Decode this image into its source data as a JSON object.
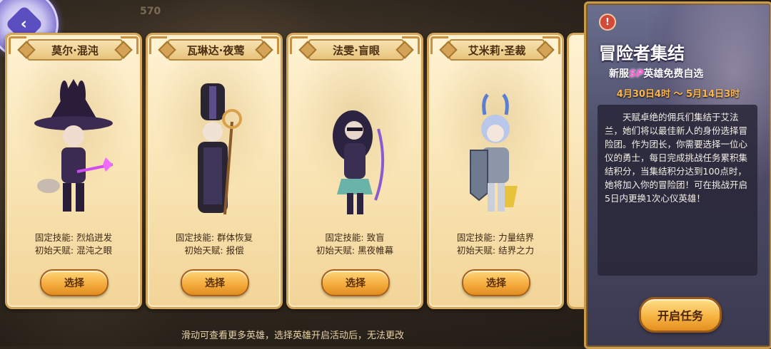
{
  "top": {
    "counter": "570"
  },
  "cards": [
    {
      "name": "莫尔·混沌",
      "fixed_skill": "固定技能: 烈焰迸发",
      "initial_talent": "初始天赋: 混沌之眼",
      "select_label": "选择",
      "hero_color": "#3b2a52",
      "accent_color": "#d04cf0"
    },
    {
      "name": "瓦琳达·夜莺",
      "fixed_skill": "固定技能: 群体恢复",
      "initial_talent": "初始天赋: 报偿",
      "select_label": "选择",
      "hero_color": "#2a2533",
      "accent_color": "#d9a24a"
    },
    {
      "name": "法雯·盲眼",
      "fixed_skill": "固定技能: 致盲",
      "initial_talent": "初始天赋: 黑夜帷幕",
      "select_label": "选择",
      "hero_color": "#2c2340",
      "accent_color": "#8a5ad0"
    },
    {
      "name": "艾米莉·圣裁",
      "fixed_skill": "固定技能: 力量结界",
      "initial_talent": "初始天赋: 结界之力",
      "select_label": "选择",
      "hero_color": "#8c96a8",
      "accent_color": "#e8c23a"
    }
  ],
  "hint": "滑动可查看更多英雄，选择英雄开启活动后，无法更改",
  "panel": {
    "alert": "!",
    "title": "冒险者集结",
    "subtitle_pre": "新服",
    "subtitle_sp": "SP",
    "subtitle_post": "英雄免费自选",
    "date": "4月30日4时 ～ 5月14日3时",
    "description": "天赋卓绝的佣兵们集结于艾法兰，她们将以最佳新人的身份选择冒险团。作为团长，你需要选择一位心仪的勇士，每日完成挑战任务累积集结积分，当集结积分达到100点时，她将加入你的冒险团！可在挑战开启5日内更换1次心仪英雄！",
    "start_label": "开启任务"
  },
  "colors": {
    "card_border": "#d5a659",
    "button_orange": "#f4a93a",
    "date_color": "#ffb64a"
  }
}
